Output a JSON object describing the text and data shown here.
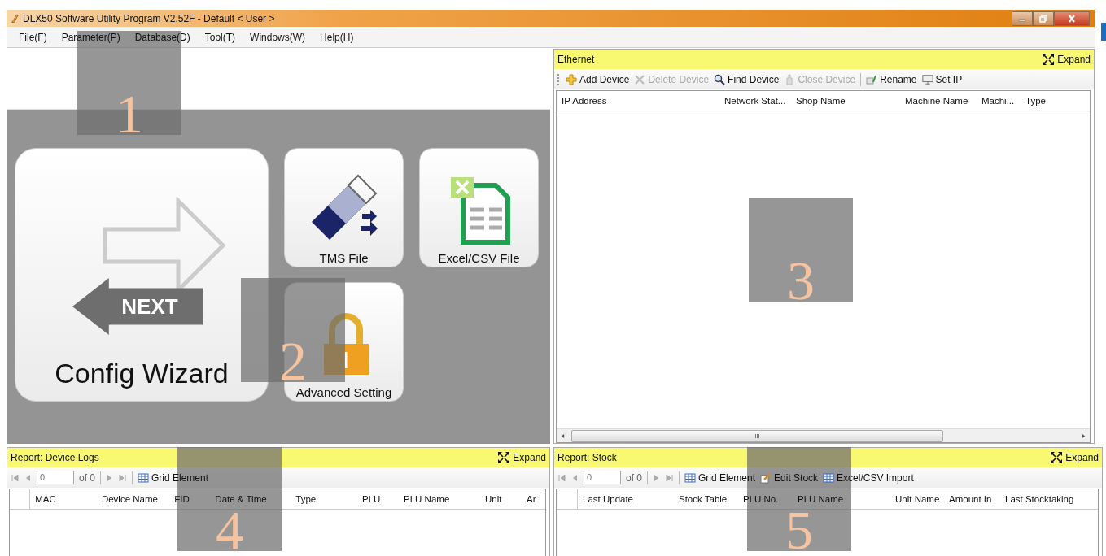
{
  "window": {
    "title": "DLX50 Software Utility Program V2.52F - Default < User >"
  },
  "menu": [
    "File(F)",
    "Parameter(P)",
    "Database(D)",
    "Tool(T)",
    "Windows(W)",
    "Help(H)"
  ],
  "launcher": {
    "tiles": [
      {
        "kind": "wizard",
        "label": "Config Wizard",
        "badge": "NEXT"
      },
      {
        "kind": "tms",
        "label": "TMS File"
      },
      {
        "kind": "excel",
        "label": "Excel/CSV File"
      },
      {
        "kind": "lock",
        "label": "Advanced Setting"
      }
    ]
  },
  "ethernet": {
    "title": "Ethernet",
    "expand": "Expand",
    "toolbar": [
      {
        "kind": "add",
        "label": "Add Device",
        "disabled": false
      },
      {
        "kind": "delete",
        "label": "Delete Device",
        "disabled": true
      },
      {
        "kind": "find",
        "label": "Find Device",
        "disabled": false
      },
      {
        "kind": "close",
        "label": "Close Device",
        "disabled": true
      },
      {
        "kind": "rename",
        "label": "Rename",
        "disabled": false
      },
      {
        "kind": "setip",
        "label": "Set IP",
        "disabled": false
      }
    ],
    "columns": [
      "IP Address",
      "Network Stat...",
      "Shop Name",
      "Machine Name",
      "Machi...",
      "Type"
    ],
    "scroll_mark": "III"
  },
  "device_logs": {
    "title": "Report: Device Logs",
    "expand": "Expand",
    "pager": {
      "page": "0",
      "of": "of 0"
    },
    "toolbar": [
      {
        "kind": "grid",
        "label": "Grid Element",
        "disabled": false
      }
    ],
    "columns": [
      "MAC",
      "Device Name",
      "FID",
      "Date & Time",
      "Type",
      "PLU",
      "PLU Name",
      "Unit",
      "Ar"
    ]
  },
  "stock": {
    "title": "Report: Stock",
    "expand": "Expand",
    "pager": {
      "page": "0",
      "of": "of 0"
    },
    "toolbar": [
      {
        "kind": "grid",
        "label": "Grid Element",
        "disabled": false
      },
      {
        "kind": "edit",
        "label": "Edit Stock",
        "disabled": false
      },
      {
        "kind": "excel",
        "label": "Excel/CSV Import",
        "disabled": false
      }
    ],
    "columns": [
      "Last Update",
      "Stock Table",
      "PLU No.",
      "PLU Name",
      "Unit Name",
      "Amount In",
      "Last Stocktaking"
    ]
  },
  "callouts": [
    "1",
    "2",
    "3",
    "4",
    "5"
  ]
}
